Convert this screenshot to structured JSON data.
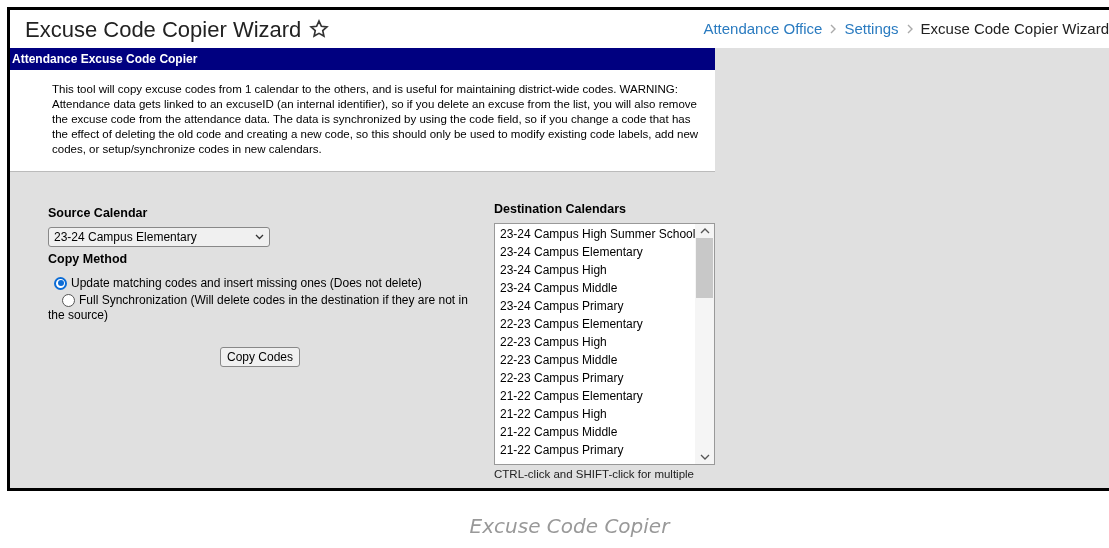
{
  "page": {
    "title": "Excuse Code Copier Wizard",
    "breadcrumb": [
      {
        "label": "Attendance Office",
        "kind": "link"
      },
      {
        "label": "Settings",
        "kind": "link"
      },
      {
        "label": "Excuse Code Copier Wizard",
        "kind": "current"
      }
    ]
  },
  "panel": {
    "title": "Attendance Excuse Code Copier",
    "description": "This tool will copy excuse codes from 1 calendar to the others, and is useful for maintaining district-wide codes. WARNING: Attendance data gets linked to an excuseID (an internal identifier), so if you delete an excuse from the list, you will also remove the excuse code from the attendance data. The data is synchronized by using the code field, so if you change a code that has the effect of deleting the old code and creating a new code, so this should only be used to modify existing code labels, add new codes, or setup/synchronize codes in new calendars."
  },
  "source_calendar": {
    "label": "Source Calendar",
    "value": "23-24 Campus Elementary"
  },
  "copy_method": {
    "label": "Copy Method",
    "options": [
      {
        "label": "Update matching codes and insert missing ones (Does not delete)",
        "selected": true
      },
      {
        "label": "Full Synchronization (Will delete codes in the destination if they are not in the source)",
        "selected": false
      }
    ]
  },
  "copy_button": "Copy Codes",
  "destination_calendars": {
    "label": "Destination Calendars",
    "items": [
      "23-24 Campus High Summer School",
      "23-24 Campus Elementary",
      "23-24 Campus High",
      "23-24 Campus Middle",
      "23-24 Campus Primary",
      "22-23 Campus Elementary",
      "22-23 Campus High",
      "22-23 Campus Middle",
      "22-23 Campus Primary",
      "21-22 Campus Elementary",
      "21-22 Campus High",
      "21-22 Campus Middle",
      "21-22 Campus Primary"
    ],
    "hint": "CTRL-click and SHIFT-click for multiple"
  },
  "caption": "Excuse Code Copier"
}
